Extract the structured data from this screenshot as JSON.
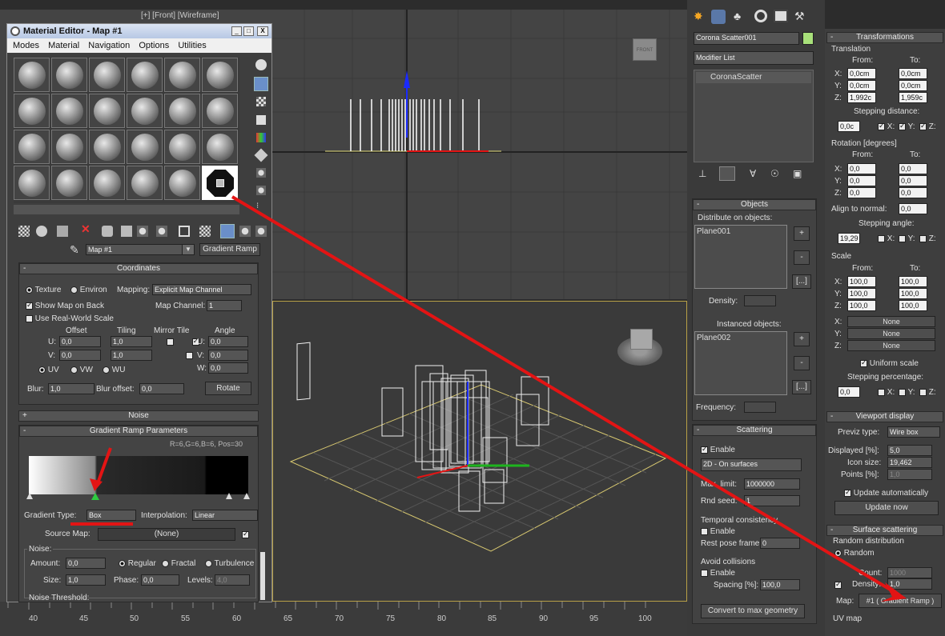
{
  "viewport": {
    "label": "[+] [Front] [Wireframe]",
    "viewcube_label": "FRONT"
  },
  "timeline": {
    "ticks": [
      "40",
      "45",
      "50",
      "55",
      "60",
      "65",
      "70",
      "75",
      "80",
      "85",
      "90",
      "95",
      "100"
    ]
  },
  "material_editor": {
    "title": "Material Editor - Map #1",
    "window_buttons": [
      "_",
      "□",
      "X"
    ],
    "menu": [
      "Modes",
      "Material",
      "Navigation",
      "Options",
      "Utilities"
    ],
    "map_name": "Map #1",
    "map_type": "Gradient Ramp",
    "coordinates": {
      "header": "Coordinates",
      "texture": "Texture",
      "environ": "Environ",
      "mapping_label": "Mapping:",
      "mapping_value": "Explicit Map Channel",
      "show_map_on_back": "Show Map on Back",
      "map_channel_label": "Map Channel:",
      "map_channel": "1",
      "use_real_world": "Use Real-World Scale",
      "col_offset": "Offset",
      "col_tiling": "Tiling",
      "col_mirror": "Mirror Tile",
      "col_angle": "Angle",
      "u": "U:",
      "v": "V:",
      "w": "W:",
      "u_offset": "0,0",
      "v_offset": "0,0",
      "u_tiling": "1,0",
      "v_tiling": "1,0",
      "u_angle": "0,0",
      "v_angle": "0,0",
      "w_angle": "0,0",
      "uv": "UV",
      "vw": "VW",
      "wu": "WU",
      "blur_label": "Blur:",
      "blur": "1,0",
      "blur_offset_label": "Blur offset:",
      "blur_offset": "0,0",
      "rotate": "Rotate"
    },
    "noise_header": "Noise",
    "gradient": {
      "header": "Gradient Ramp Parameters",
      "readout": "R=6,G=6,B=6, Pos=30",
      "type_label": "Gradient Type:",
      "type_value": "Box",
      "interp_label": "Interpolation:",
      "interp_value": "Linear",
      "source_map_label": "Source Map:",
      "source_map_value": "(None)",
      "noise_group": "Noise:",
      "amount_label": "Amount:",
      "amount": "0,0",
      "regular": "Regular",
      "fractal": "Fractal",
      "turbulence": "Turbulence",
      "size_label": "Size:",
      "size": "1,0",
      "phase_label": "Phase:",
      "phase": "0,0",
      "levels_label": "Levels:",
      "levels": "4,0",
      "noise_threshold": "Noise Threshold:"
    }
  },
  "command_panel": {
    "object_name": "Corona Scatter001",
    "modifier_list": "Modifier List",
    "stack_item": "CoronaScatter",
    "objects": {
      "header": "Objects",
      "distribute_label": "Distribute on objects:",
      "distribute_item": "Plane001",
      "plus": "+",
      "minus": "-",
      "more": "[...]",
      "density_label": "Density:",
      "instanced_label": "Instanced objects:",
      "instanced_item": "Plane002",
      "frequency_label": "Frequency:"
    },
    "scattering": {
      "header": "Scattering",
      "enable": "Enable",
      "mode": "2D - On surfaces",
      "max_limit_label": "Max. limit:",
      "max_limit": "1000000",
      "rnd_seed_label": "Rnd seed:",
      "rnd_seed": "1",
      "temporal_label": "Temporal consistency",
      "temporal_enable": "Enable",
      "rest_pose_label": "Rest pose frame:",
      "rest_pose": "0",
      "avoid_label": "Avoid collisions",
      "avoid_enable": "Enable",
      "spacing_label": "Spacing [%]:",
      "spacing": "100,0",
      "convert": "Convert to max geometry"
    }
  },
  "transform_panel": {
    "header": "Transformations",
    "translation": "Translation",
    "from": "From:",
    "to": "To:",
    "x": "X:",
    "y": "Y:",
    "z": "Z:",
    "t_from": [
      "0,0cm",
      "0,0cm",
      "1,992c"
    ],
    "t_to": [
      "0,0cm",
      "0,0cm",
      "1,959c"
    ],
    "stepping_distance": "Stepping distance:",
    "stepping_distance_value": "0,0c",
    "rotation": "Rotation [degrees]",
    "r_from": [
      "0,0",
      "0,0",
      "0,0"
    ],
    "r_to": [
      "0,0",
      "0,0",
      "0,0"
    ],
    "align_label": "Align to normal:",
    "align_value": "0,0",
    "stepping_angle": "Stepping angle:",
    "stepping_angle_value": "19,29",
    "scale": "Scale",
    "s_from": [
      "100,0",
      "100,0",
      "100,0"
    ],
    "s_to": [
      "100,0",
      "100,0",
      "100,0"
    ],
    "none": "None",
    "uniform_scale": "Uniform scale",
    "stepping_percentage": "Stepping percentage:",
    "stepping_percentage_value": "0,0",
    "viewport_header": "Viewport display",
    "previz_label": "Previz type:",
    "previz_value": "Wire box",
    "displayed_label": "Displayed [%]:",
    "displayed": "5,0",
    "icon_size_label": "Icon size:",
    "icon_size": "19,462",
    "points_label": "Points [%]:",
    "points": "1,0",
    "update_auto": "Update automatically",
    "update_now": "Update now",
    "surface_header": "Surface scattering",
    "random_distribution": "Random distribution",
    "random": "Random",
    "count_label": "Count:",
    "count": "1000",
    "density_label": "Density:",
    "density": "1,0",
    "map_label": "Map:",
    "map_value": "#1 ( Gradient Ramp )",
    "uv_map": "UV map"
  }
}
